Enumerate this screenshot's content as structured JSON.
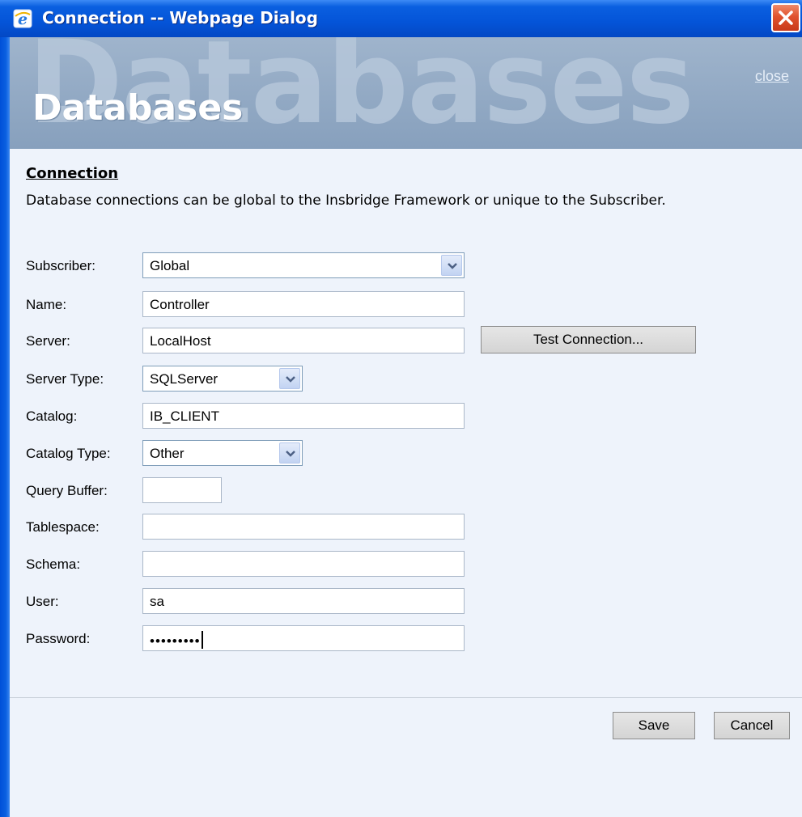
{
  "window": {
    "title": "Connection -- Webpage Dialog",
    "icon": "internet-explorer-icon",
    "close_icon": "close-x-icon"
  },
  "banner": {
    "watermark": "Databases",
    "title": "Databases",
    "close_link": "close"
  },
  "section": {
    "heading": "Connection",
    "description": "Database connections can be global to the Insbridge Framework or unique to the Subscriber."
  },
  "form": {
    "subscriber": {
      "label": "Subscriber:",
      "value": "Global"
    },
    "name": {
      "label": "Name:",
      "value": "Controller"
    },
    "server": {
      "label": "Server:",
      "value": "LocalHost"
    },
    "server_type": {
      "label": "Server Type:",
      "value": "SQLServer"
    },
    "catalog": {
      "label": "Catalog:",
      "value": "IB_CLIENT"
    },
    "catalog_type": {
      "label": "Catalog Type:",
      "value": "Other"
    },
    "query_buffer": {
      "label": "Query Buffer:",
      "value": ""
    },
    "tablespace": {
      "label": "Tablespace:",
      "value": ""
    },
    "schema": {
      "label": "Schema:",
      "value": ""
    },
    "user": {
      "label": "User:",
      "value": "sa"
    },
    "password": {
      "label": "Password:",
      "value": "•••••••••"
    }
  },
  "buttons": {
    "test_connection": "Test Connection...",
    "save": "Save",
    "cancel": "Cancel"
  },
  "colors": {
    "titlebar": "#0454d8",
    "banner": "#8ea6c2",
    "content_bg": "#eef3fb",
    "close_button": "#e0532e"
  }
}
